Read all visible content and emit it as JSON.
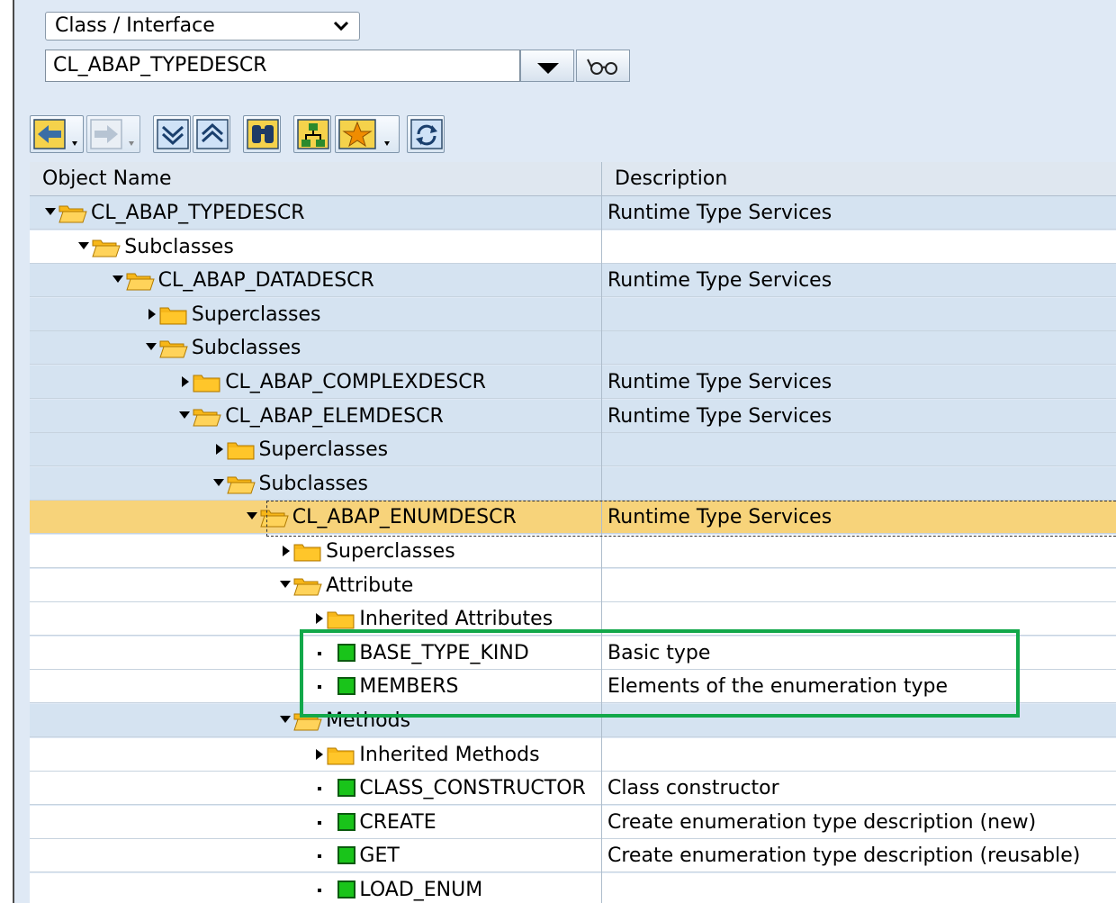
{
  "selector": {
    "type_label": "Class / Interface",
    "object_value": "CL_ABAP_TYPEDESCR"
  },
  "toolbar": {
    "icons": [
      "back-icon",
      "forward-icon",
      "expand-all-icon",
      "collapse-all-icon",
      "find-icon",
      "hierarchy-icon",
      "favorites-icon",
      "refresh-icon"
    ]
  },
  "columns": {
    "name": "Object Name",
    "description": "Description"
  },
  "rows": [
    {
      "name": "CL_ABAP_TYPEDESCR",
      "description": "Runtime Type Services"
    },
    {
      "name": "Subclasses",
      "description": ""
    },
    {
      "name": "CL_ABAP_DATADESCR",
      "description": "Runtime Type Services"
    },
    {
      "name": "Superclasses",
      "description": ""
    },
    {
      "name": "Subclasses",
      "description": ""
    },
    {
      "name": "CL_ABAP_COMPLEXDESCR",
      "description": "Runtime Type Services"
    },
    {
      "name": "CL_ABAP_ELEMDESCR",
      "description": "Runtime Type Services"
    },
    {
      "name": "Superclasses",
      "description": ""
    },
    {
      "name": "Subclasses",
      "description": ""
    },
    {
      "name": "CL_ABAP_ENUMDESCR",
      "description": "Runtime Type Services"
    },
    {
      "name": "Superclasses",
      "description": ""
    },
    {
      "name": "Attribute",
      "description": ""
    },
    {
      "name": "Inherited Attributes",
      "description": ""
    },
    {
      "name": "BASE_TYPE_KIND",
      "description": "Basic type"
    },
    {
      "name": "MEMBERS",
      "description": "Elements of the enumeration type"
    },
    {
      "name": "Methods",
      "description": ""
    },
    {
      "name": "Inherited Methods",
      "description": ""
    },
    {
      "name": "CLASS_CONSTRUCTOR",
      "description": "Class constructor"
    },
    {
      "name": "CREATE",
      "description": "Create enumeration type description (new)"
    },
    {
      "name": "GET",
      "description": "Create enumeration type description (reusable)"
    },
    {
      "name": "LOAD_ENUM",
      "description": ""
    }
  ],
  "colors": {
    "highlight_box": "#12a84a",
    "selected_row": "#f7d37a",
    "leaf_icon": "#19c41a",
    "folder": "#f7b719"
  }
}
